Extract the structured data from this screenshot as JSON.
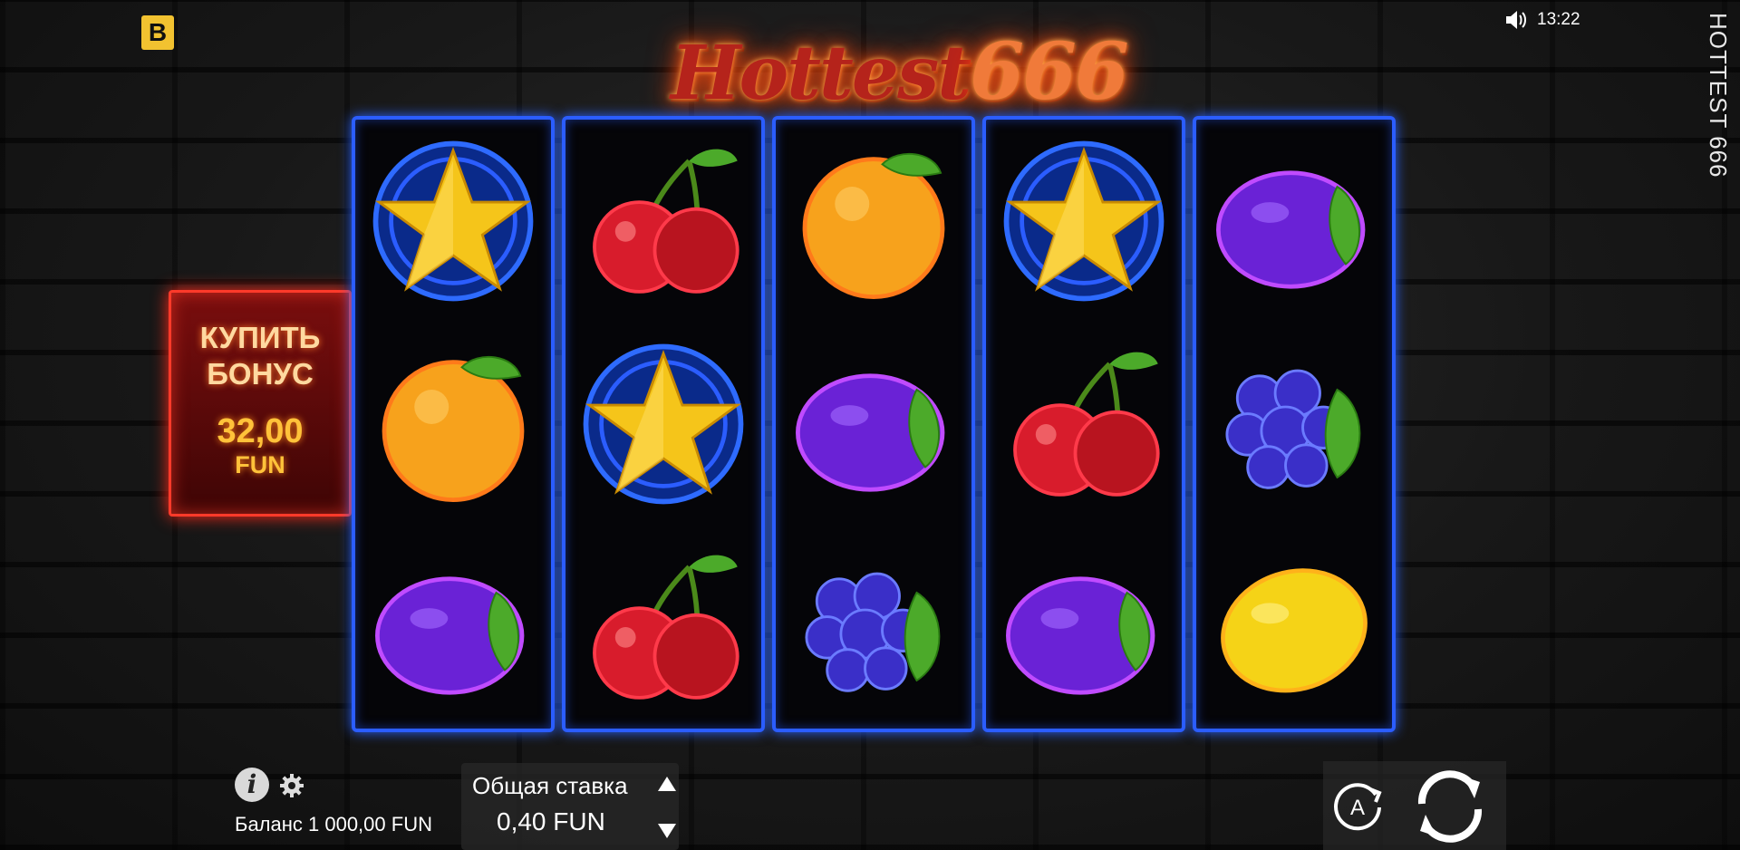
{
  "header": {
    "brand_logo_text": "B",
    "time": "13:22",
    "sound_icon": "speaker-icon",
    "side_title": "HOTTEST 666"
  },
  "game_logo": {
    "word": "Hottest",
    "number": "666"
  },
  "buy_bonus": {
    "line1": "КУПИТЬ",
    "line2": "БОНУС",
    "price": "32,00",
    "currency": "FUN"
  },
  "reels": [
    [
      "star",
      "orange",
      "plum"
    ],
    [
      "cherry",
      "star",
      "cherry"
    ],
    [
      "orange",
      "plum",
      "grapes"
    ],
    [
      "star",
      "cherry",
      "plum"
    ],
    [
      "plum",
      "grapes",
      "lemon"
    ]
  ],
  "bottom": {
    "info_label": "i",
    "balance": "Баланс 1 000,00 FUN",
    "bet_label": "Общая ставка",
    "bet_value": "0,40 FUN",
    "autoplay_label": "A",
    "icons": {
      "info": "info-icon",
      "settings": "gear-icon",
      "bet_up": "arrow-up-icon",
      "bet_down": "arrow-down-icon",
      "autoplay": "autoplay-icon",
      "spin": "spin-icon"
    }
  },
  "colors": {
    "reel_border": "#2b5dff",
    "bonus_border": "#ff3a2a",
    "brand_logo": "#f2c230"
  }
}
